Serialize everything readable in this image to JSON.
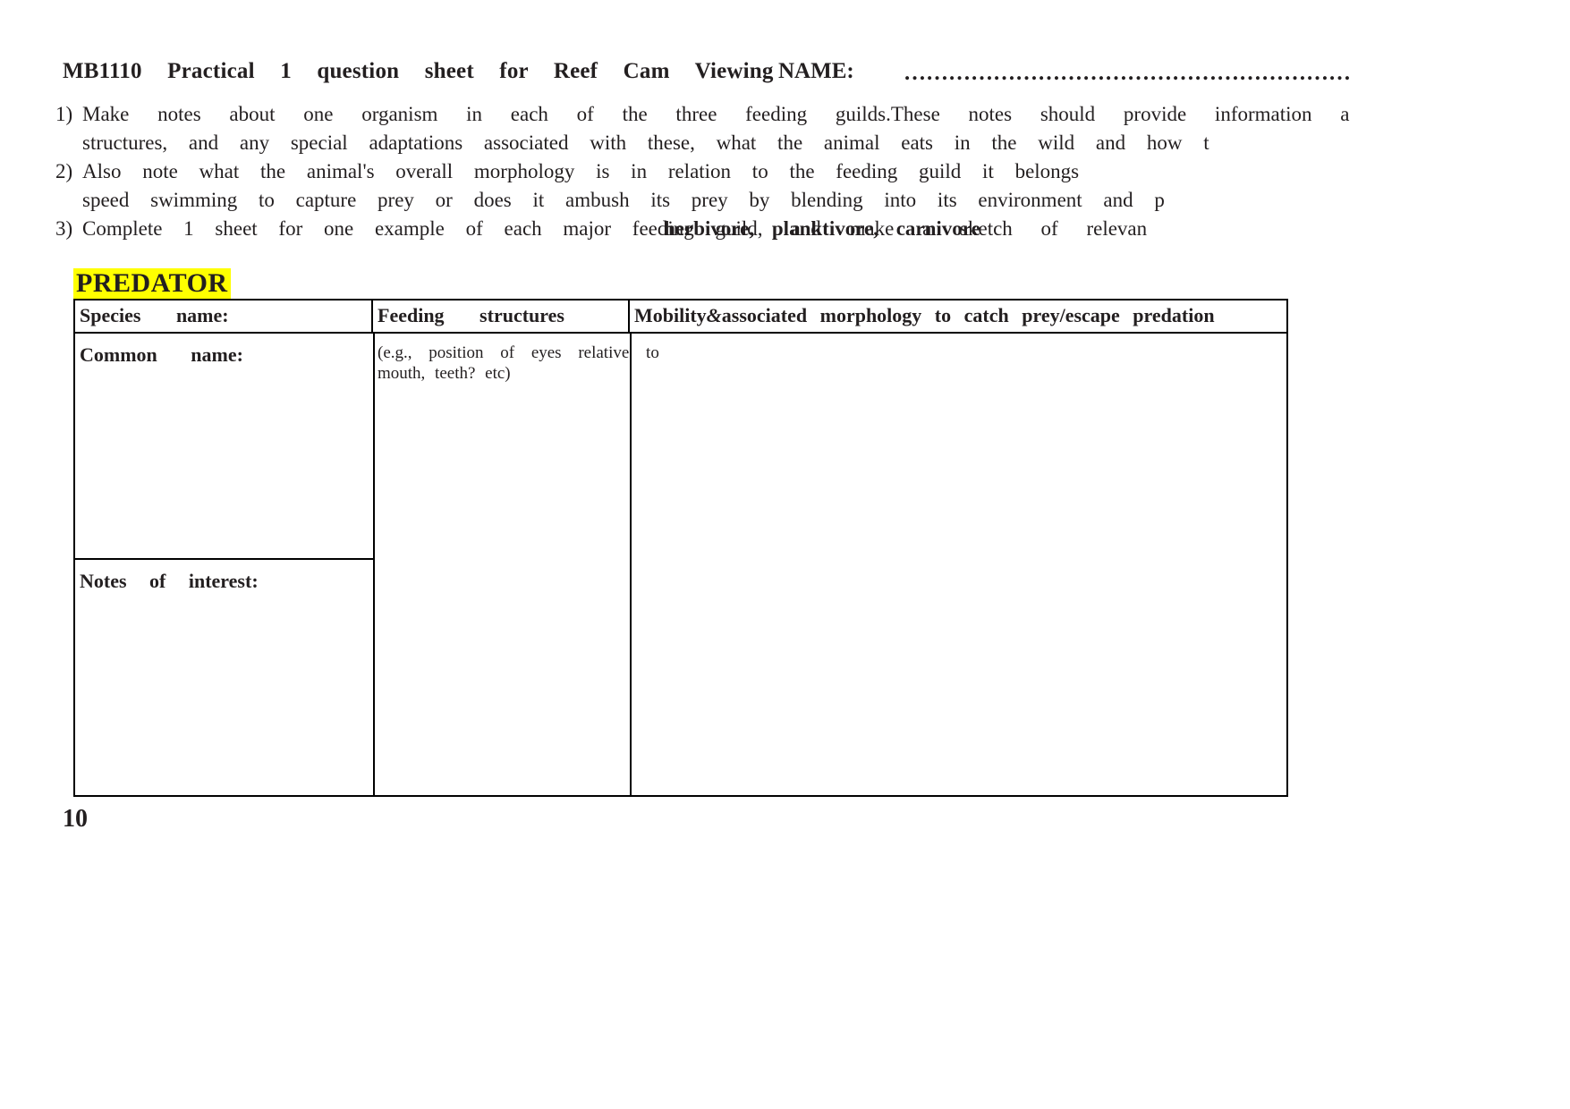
{
  "document": {
    "title_main": "MB1110      Practical    1       question     sheet for     Reef  Cam  Viewing",
    "name_label": "NAME:",
    "name_dots": "……………………………………………………",
    "instructions": {
      "item1_num": "1)",
      "line1a": "Make  notes  about one      organism      in       each   of       the      three feeding       guilds.",
      "line1b": "These notes  should          provide        information a",
      "line2a": "structures,    and    any    special        adaptations  associated    with    these, what   the     animal      eats  in       the    wild    and    how t",
      "item2_num": "2)",
      "line3": "Also   note   what   the     animal's      overall          morphology  is      in     relation       to      the     feeding       guild  it      belongs",
      "line4": "speed swimming     to      capture        prey  or      does  it      ambush      its     prey  by    blending      into   its     environment and    p",
      "item3_num": "3)",
      "line5_base": "Complete    1        sheet  for     one     example     of      each major feeding guild,",
      "line5_overlay": "herbivore, planktivore, carnivore",
      "line5_tail": "and    make  a       sketch of      relevan"
    },
    "section_heading": "PREDATOR",
    "table": {
      "headers": [
        "Species          name:",
        "Feeding         structures",
        "Mobility & associated   morphology to      catch  prey/escape predation"
      ],
      "header3_part1": "Mobility",
      "header3_amp": "&",
      "header3_part2": "associated   morphology to      catch  prey/escape predation",
      "rows": {
        "common_name_label": "Common         name:",
        "notes_label": "Notes of       interest:",
        "feeding_hint_line1": "(e.g.,     position of      eyes     relative to",
        "feeding_hint_line2": "mouth,  teeth?   etc)",
        "mobility_value": ""
      }
    },
    "page_number": "10",
    "colors": {
      "highlight": "#ffff00",
      "text": "#231f20",
      "border": "#000000"
    }
  }
}
